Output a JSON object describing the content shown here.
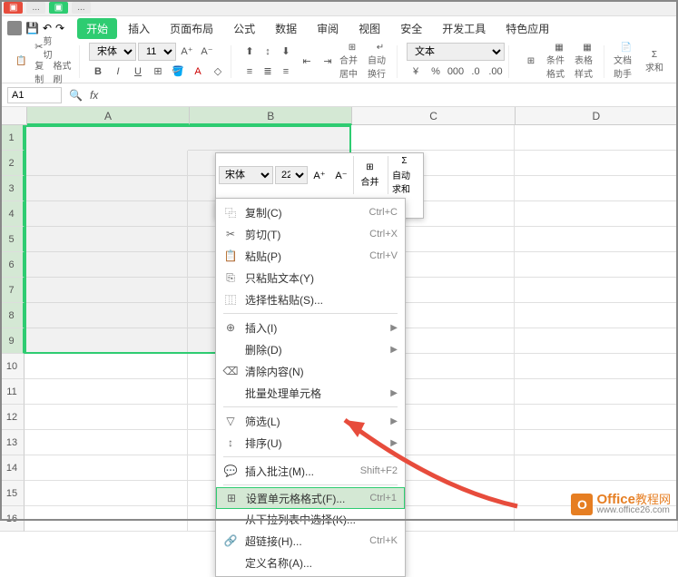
{
  "menu": {
    "items": [
      "开始",
      "插入",
      "页面布局",
      "公式",
      "数据",
      "审阅",
      "视图",
      "安全",
      "开发工具",
      "特色应用"
    ]
  },
  "ribbon": {
    "cut": "剪切",
    "copy": "复制",
    "fmt": "格式刷",
    "font_name": "宋体",
    "font_size": "11",
    "merge": "合并居中",
    "wrap": "自动换行",
    "num_fmt": "文本",
    "cond_fmt": "条件格式",
    "table_fmt": "表格样式",
    "doc_helper": "文档助手",
    "sum": "求和"
  },
  "name_box": "A1",
  "fx": "fx",
  "cols": [
    "A",
    "B",
    "C",
    "D"
  ],
  "rows": [
    "1",
    "2",
    "3",
    "4",
    "5",
    "6",
    "7",
    "8",
    "9",
    "10",
    "11",
    "12",
    "13",
    "14",
    "15",
    "16"
  ],
  "mini": {
    "font": "宋体",
    "size": "22",
    "merge": "合并",
    "sum": "自动求和"
  },
  "ctx": {
    "copy": "复制(C)",
    "copy_k": "Ctrl+C",
    "cut": "剪切(T)",
    "cut_k": "Ctrl+X",
    "paste": "粘贴(P)",
    "paste_k": "Ctrl+V",
    "paste_text": "只粘贴文本(Y)",
    "paste_special": "选择性粘贴(S)...",
    "insert": "插入(I)",
    "delete": "删除(D)",
    "clear": "清除内容(N)",
    "batch": "批量处理单元格",
    "filter": "筛选(L)",
    "sort": "排序(U)",
    "comment": "插入批注(M)...",
    "comment_k": "Shift+F2",
    "format": "设置单元格格式(F)...",
    "format_k": "Ctrl+1",
    "dropdown": "从下拉列表中选择(K)...",
    "hyperlink": "超链接(H)...",
    "hyperlink_k": "Ctrl+K",
    "define": "定义名称(A)..."
  },
  "watermark": {
    "main": "Office",
    "cn": "教程网",
    "url": "www.office26.com"
  }
}
